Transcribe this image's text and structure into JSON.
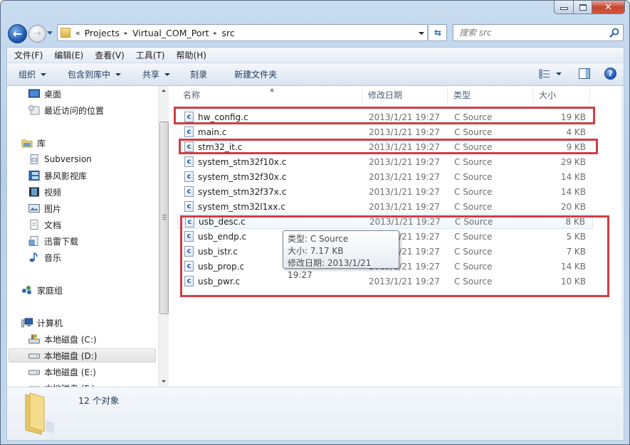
{
  "window": {
    "caption_buttons": {
      "minimize": "minimize",
      "maximize": "maximize",
      "close": "✕"
    }
  },
  "nav": {
    "back_icon": "←",
    "forward_icon": "→",
    "address": {
      "overflow": "«",
      "crumbs": [
        "Projects",
        "Virtual_COM_Port",
        "src"
      ],
      "separator": "▸"
    },
    "refresh_icon": "⇆",
    "search_placeholder": "搜索 src"
  },
  "menubar": {
    "items": [
      "文件(F)",
      "编辑(E)",
      "查看(V)",
      "工具(T)",
      "帮助(H)"
    ]
  },
  "commandbar": {
    "organize": "组织",
    "include_in_library": "包含到库中",
    "share": "共享",
    "burn": "刻录",
    "new_folder": "新建文件夹",
    "help_icon": "?"
  },
  "sidebar": {
    "items": [
      {
        "label": "桌面",
        "icon": "desktop-icon"
      },
      {
        "label": "最近访问的位置",
        "icon": "recent-places-icon"
      },
      {
        "label": "库",
        "icon": "library-icon"
      },
      {
        "label": "Subversion",
        "icon": "document-library-icon"
      },
      {
        "label": "暴风影视库",
        "icon": "video-library-icon"
      },
      {
        "label": "视频",
        "icon": "video-icon"
      },
      {
        "label": "图片",
        "icon": "pictures-icon"
      },
      {
        "label": "文档",
        "icon": "documents-icon"
      },
      {
        "label": "迅雷下载",
        "icon": "downloads-icon"
      },
      {
        "label": "音乐",
        "icon": "music-icon"
      },
      {
        "label": "家庭组",
        "icon": "homegroup-icon"
      },
      {
        "label": "计算机",
        "icon": "computer-icon"
      },
      {
        "label": "本地磁盘 (C:)",
        "icon": "system-drive-icon"
      },
      {
        "label": "本地磁盘 (D:)",
        "icon": "drive-icon",
        "selected": true
      },
      {
        "label": "本地磁盘 (E:)",
        "icon": "drive-icon"
      },
      {
        "label": "本地磁盘 (F:)",
        "icon": "drive-icon"
      }
    ]
  },
  "filelist": {
    "columns": {
      "name": "名称",
      "date": "修改日期",
      "type": "类型",
      "size": "大小"
    },
    "file_icon_glyph": "c",
    "rows": [
      {
        "name": "hw_config.c",
        "date": "2013/1/21 19:27",
        "type": "C Source",
        "size": "19 KB"
      },
      {
        "name": "main.c",
        "date": "2013/1/21 19:27",
        "type": "C Source",
        "size": "4 KB"
      },
      {
        "name": "stm32_it.c",
        "date": "2013/1/21 19:27",
        "type": "C Source",
        "size": "9 KB"
      },
      {
        "name": "system_stm32f10x.c",
        "date": "2013/1/21 19:27",
        "type": "C Source",
        "size": "29 KB"
      },
      {
        "name": "system_stm32f30x.c",
        "date": "2013/1/21 19:27",
        "type": "C Source",
        "size": "14 KB"
      },
      {
        "name": "system_stm32f37x.c",
        "date": "2013/1/21 19:27",
        "type": "C Source",
        "size": "14 KB"
      },
      {
        "name": "system_stm32l1xx.c",
        "date": "2013/1/21 19:27",
        "type": "C Source",
        "size": "20 KB"
      },
      {
        "name": "usb_desc.c",
        "date": "2013/1/21 19:27",
        "type": "C Source",
        "size": "8 KB"
      },
      {
        "name": "usb_endp.c",
        "date": "2013/1/21 19:27",
        "type": "C Source",
        "size": "5 KB"
      },
      {
        "name": "usb_istr.c",
        "date": "2013/1/21 19:27",
        "type": "C Source",
        "size": "7 KB"
      },
      {
        "name": "usb_prop.c",
        "date": "2013/1/21 19:27",
        "type": "C Source",
        "size": "14 KB"
      },
      {
        "name": "usb_pwr.c",
        "date": "2013/1/21 19:27",
        "type": "C Source",
        "size": "10 KB"
      }
    ],
    "hovered_row": "usb_desc.c"
  },
  "tooltip": {
    "type_line": "类型: C Source",
    "size_line": "大小: 7.17 KB",
    "date_line": "修改日期: 2013/1/21 19:27"
  },
  "annotations": {
    "color": "#d23c43",
    "highlighted_groups": [
      [
        "hw_config.c"
      ],
      [
        "stm32_it.c"
      ],
      [
        "usb_desc.c",
        "usb_endp.c",
        "usb_istr.c",
        "usb_prop.c",
        "usb_pwr.c"
      ]
    ]
  },
  "details": {
    "count": "12 个对象"
  }
}
